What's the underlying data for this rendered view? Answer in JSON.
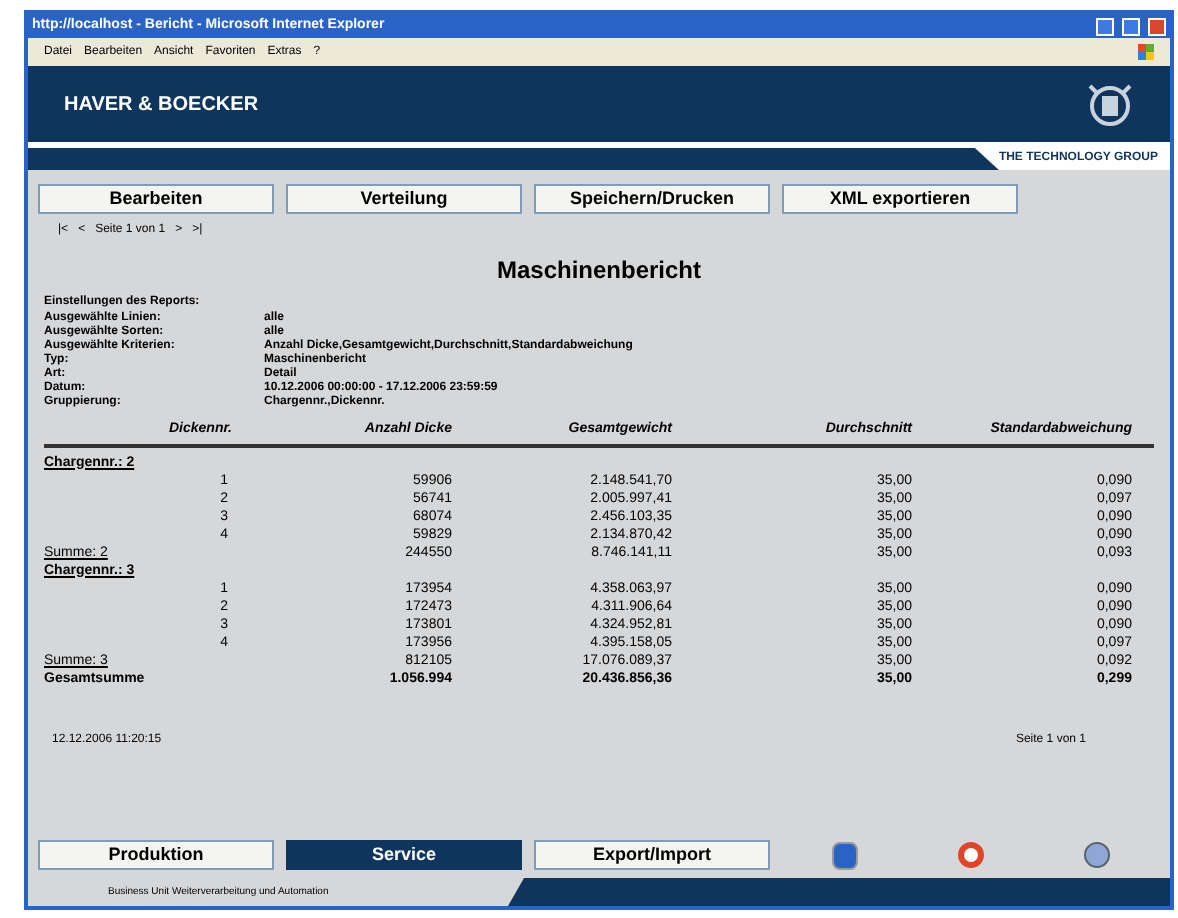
{
  "window": {
    "title": "http://localhost - Bericht - Microsoft Internet Explorer"
  },
  "menu": [
    "Datei",
    "Bearbeiten",
    "Ansicht",
    "Favoriten",
    "Extras",
    "?"
  ],
  "header": {
    "brand": "HAVER & BOECKER",
    "tagline": "THE TECHNOLOGY GROUP"
  },
  "toolbar": [
    "Bearbeiten",
    "Verteilung",
    "Speichern/Drucken",
    "XML exportieren"
  ],
  "pager": {
    "first": "|<",
    "prev": "<",
    "label": "Seite 1 von 1",
    "next": ">",
    "last": ">|"
  },
  "report": {
    "title": "Maschinenbericht",
    "settings_heading": "Einstellungen des Reports:",
    "settings": [
      {
        "label": "Ausgewählte Linien:",
        "value": "alle"
      },
      {
        "label": "Ausgewählte Sorten:",
        "value": "alle"
      },
      {
        "label": "Ausgewählte Kriterien:",
        "value": "Anzahl Dicke,Gesamtgewicht,Durchschnitt,Standardabweichung"
      },
      {
        "label": "Typ:",
        "value": "Maschinenbericht"
      },
      {
        "label": "Art:",
        "value": "Detail"
      },
      {
        "label": "Datum:",
        "value": "10.12.2006 00:00:00 - 17.12.2006 23:59:59"
      },
      {
        "label": "Gruppierung:",
        "value": "Chargennr.,Dickennr."
      }
    ],
    "columns": [
      "Dickennr.",
      "Anzahl Dicke",
      "Gesamtgewicht",
      "Durchschnitt",
      "Standardabweichung"
    ],
    "rows": [
      {
        "kind": "group",
        "label": "Chargennr.: 2"
      },
      {
        "kind": "row",
        "cells": [
          "1",
          "59906",
          "2.148.541,70",
          "35,00",
          "0,090"
        ]
      },
      {
        "kind": "row",
        "cells": [
          "2",
          "56741",
          "2.005.997,41",
          "35,00",
          "0,097"
        ]
      },
      {
        "kind": "row",
        "cells": [
          "3",
          "68074",
          "2.456.103,35",
          "35,00",
          "0,090"
        ]
      },
      {
        "kind": "row",
        "cells": [
          "4",
          "59829",
          "2.134.870,42",
          "35,00",
          "0,090"
        ]
      },
      {
        "kind": "sum",
        "label": "Summe: 2",
        "cells": [
          "",
          "244550",
          "8.746.141,11",
          "35,00",
          "0,093"
        ]
      },
      {
        "kind": "group",
        "label": "Chargennr.: 3"
      },
      {
        "kind": "row",
        "cells": [
          "1",
          "173954",
          "4.358.063,97",
          "35,00",
          "0,090"
        ]
      },
      {
        "kind": "row",
        "cells": [
          "2",
          "172473",
          "4.311.906,64",
          "35,00",
          "0,090"
        ]
      },
      {
        "kind": "row",
        "cells": [
          "3",
          "173801",
          "4.324.952,81",
          "35,00",
          "0,090"
        ]
      },
      {
        "kind": "row",
        "cells": [
          "4",
          "173956",
          "4.395.158,05",
          "35,00",
          "0,097"
        ]
      },
      {
        "kind": "sum",
        "label": "Summe: 3",
        "cells": [
          "",
          "812105",
          "17.076.089,37",
          "35,00",
          "0,092"
        ]
      },
      {
        "kind": "total",
        "label": "Gesamtsumme",
        "cells": [
          "",
          "1.056.994",
          "20.436.856,36",
          "35,00",
          "0,299"
        ]
      }
    ],
    "printed": "12.12.2006 11:20:15",
    "page": "Seite 1 von 1"
  },
  "nav": [
    {
      "label": "Produktion",
      "selected": false
    },
    {
      "label": "Service",
      "selected": true
    },
    {
      "label": "Export/Import",
      "selected": false
    }
  ],
  "status": "Business Unit Weiterverarbeitung und Automation"
}
